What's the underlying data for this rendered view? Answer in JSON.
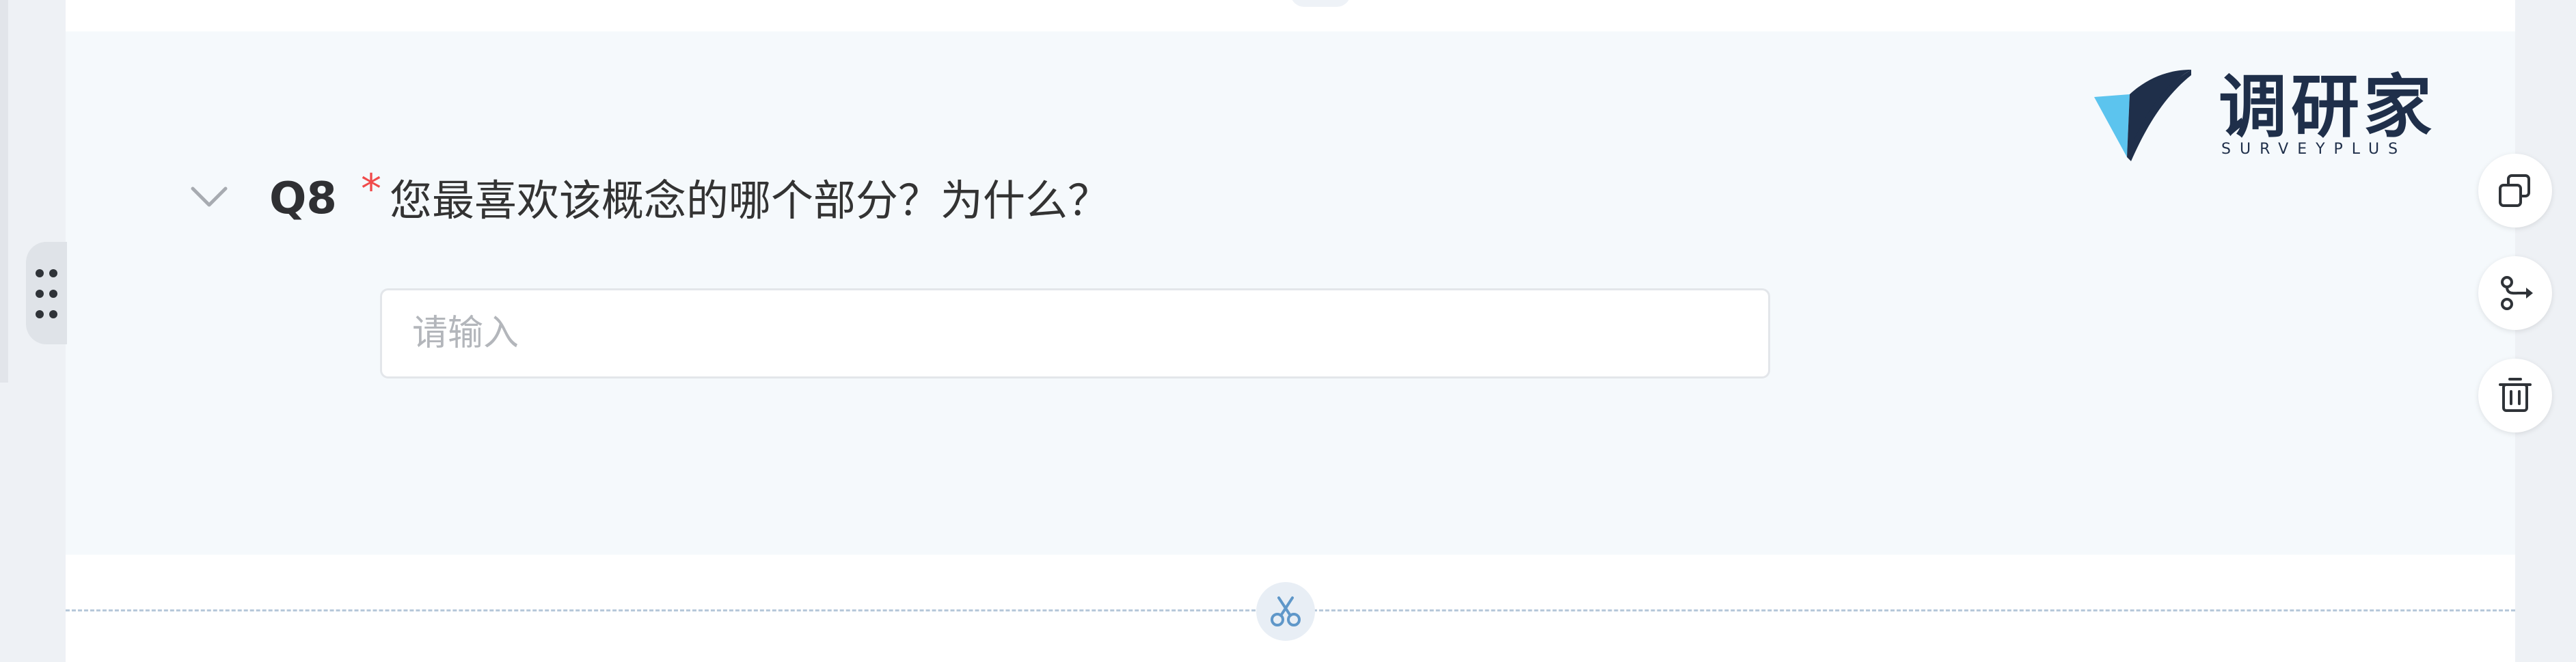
{
  "question": {
    "number": "Q8",
    "required_mark": "*",
    "title": "您最喜欢该概念的哪个部分？为什么？",
    "input": {
      "value": "",
      "placeholder": "请输入"
    }
  },
  "logo": {
    "name_cn": "调研家",
    "name_en": "SURVEYPLUS"
  },
  "actions": {
    "copy_icon": "copy-icon",
    "logic_icon": "logic-jump-icon",
    "delete_icon": "trash-icon"
  },
  "page_break": {
    "icon": "scissors-icon"
  },
  "colors": {
    "accent_logo_dark": "#1f2f4a",
    "accent_logo_light": "#4fb8e6",
    "required": "#f04b4b",
    "card_bg": "#f5f9fc"
  }
}
